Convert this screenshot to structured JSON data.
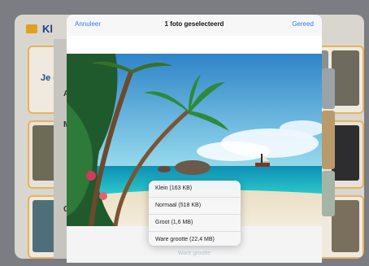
{
  "background_app": {
    "title_fragment": "Kl",
    "card_text": "Je c",
    "side_letters": [
      "A",
      "M",
      "G"
    ]
  },
  "sheet": {
    "cancel_label": "Annuleer",
    "title": "1 foto geselecteerd",
    "done_label": "Gereed",
    "bottom_label": "Ware grootte"
  },
  "size_menu": {
    "items": [
      {
        "label": "Klein (163 KB)"
      },
      {
        "label": "Normaal (518 KB)"
      },
      {
        "label": "Groot (1,6 MB)"
      },
      {
        "label": "Ware grootte (22,4 MB)"
      }
    ]
  },
  "colors": {
    "accent_blue": "#2f7af5",
    "folder_orange": "#e0a020",
    "card_border": "#e6b35e"
  }
}
